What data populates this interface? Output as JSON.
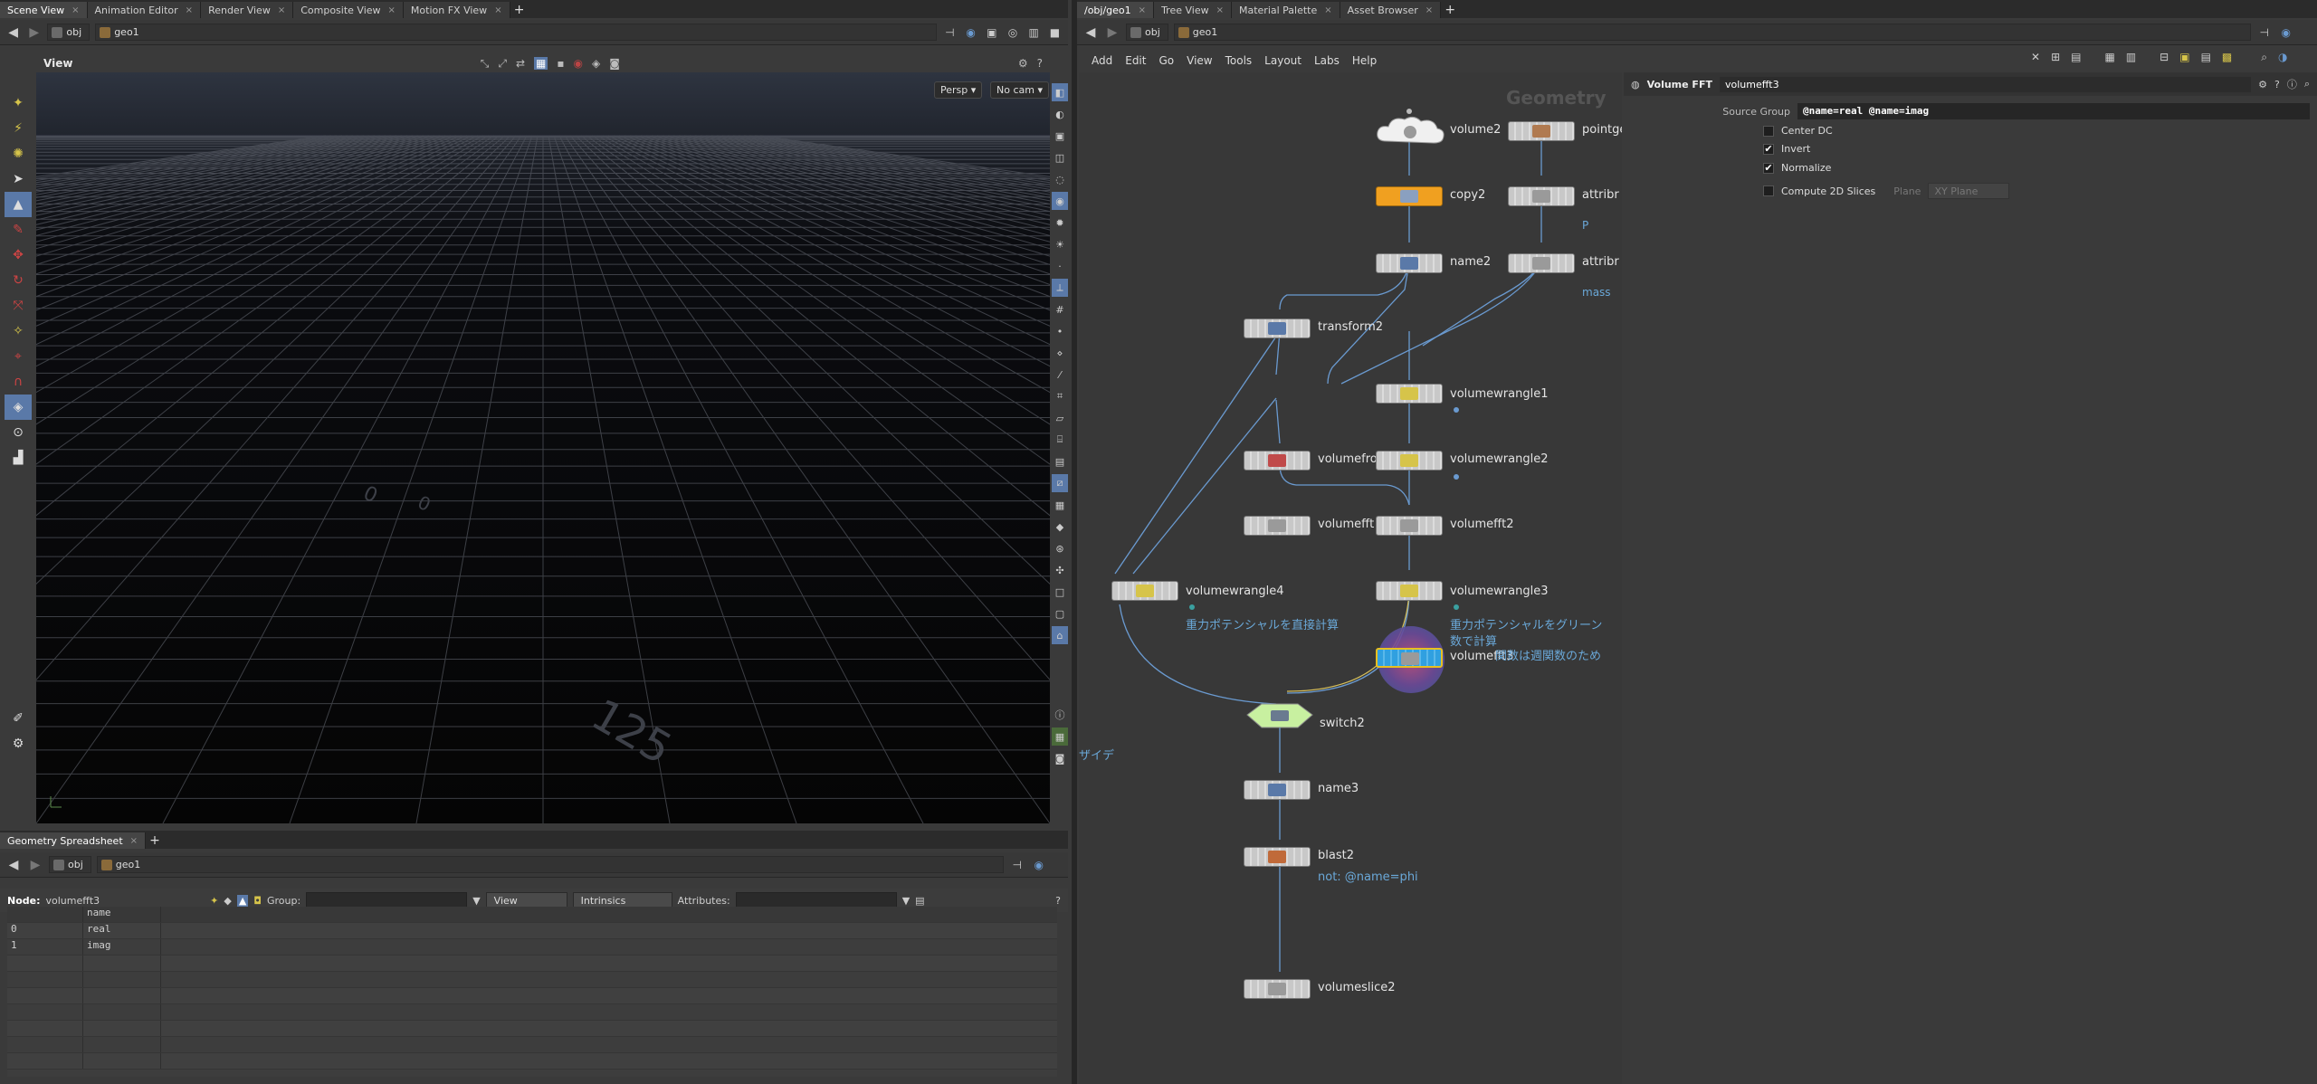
{
  "left_tabs": [
    {
      "label": "Scene View",
      "active": true
    },
    {
      "label": "Animation Editor",
      "active": false
    },
    {
      "label": "Render View",
      "active": false
    },
    {
      "label": "Composite View",
      "active": false
    },
    {
      "label": "Motion FX View",
      "active": false
    }
  ],
  "right_tabs": [
    {
      "label": "/obj/geo1",
      "active": true
    },
    {
      "label": "Tree View",
      "active": false
    },
    {
      "label": "Material Palette",
      "active": false
    },
    {
      "label": "Asset Browser",
      "active": false
    }
  ],
  "left_path": {
    "level1": "obj",
    "level2": "geo1"
  },
  "right_path": {
    "level1": "obj",
    "level2": "geo1"
  },
  "viewport": {
    "title": "View",
    "persp_label": "Persp ▾",
    "cam_label": "No cam ▾",
    "grid_labels": [
      "0",
      "0",
      "125"
    ]
  },
  "spreadsheet": {
    "tab_label": "Geometry Spreadsheet",
    "path": {
      "level1": "obj",
      "level2": "geo1"
    },
    "node_label": "Node:",
    "node_value": "volumefft3",
    "group_label": "Group:",
    "view_label": "View",
    "intrinsics_label": "Intrinsics",
    "attributes_label": "Attributes:",
    "column_header": "name",
    "rows": [
      {
        "index": "0",
        "name": "real"
      },
      {
        "index": "1",
        "name": "imag"
      }
    ]
  },
  "network": {
    "menu": [
      "Add",
      "Edit",
      "Go",
      "View",
      "Tools",
      "Layout",
      "Labs",
      "Help"
    ],
    "context_title": "Geometry",
    "side_note": "ザイデ",
    "nodes": [
      {
        "name": "volume2"
      },
      {
        "name": "pointge"
      },
      {
        "name": "copy2"
      },
      {
        "name": "attribr"
      },
      {
        "name": "name2"
      },
      {
        "name": "attribr"
      },
      {
        "name": "transform2"
      },
      {
        "name": "volumewrangle1"
      },
      {
        "name": "volumefro"
      },
      {
        "name": "volumewrangle2"
      },
      {
        "name": "volumefft"
      },
      {
        "name": "volumefft2"
      },
      {
        "name": "volumewrangle4"
      },
      {
        "name": "volumewrangle3"
      },
      {
        "name": "volumefft3"
      },
      {
        "name": "switch2"
      },
      {
        "name": "name3"
      },
      {
        "name": "blast2"
      },
      {
        "name": "volumeslice2"
      }
    ],
    "notes": {
      "attrib1_note": "P",
      "attrib2_note": "mass",
      "wrangle4_note": "重力ポテンシャルを直接計算",
      "wrangle3_note_line1": "重力ポテンシャルをグリーン",
      "wrangle3_note_line2": "数で計算",
      "fft3_note": "関数は週関数のため",
      "blast_note": "not: @name=phi"
    }
  },
  "parameters": {
    "node_type": "Volume FFT",
    "node_name": "volumefft3",
    "source_group_label": "Source Group",
    "source_group_value": "@name=real @name=imag",
    "center_dc": {
      "label": "Center DC",
      "checked": false
    },
    "invert": {
      "label": "Invert",
      "checked": true
    },
    "normalize": {
      "label": "Normalize",
      "checked": true
    },
    "compute_2d": {
      "label": "Compute 2D Slices",
      "checked": false
    },
    "plane_label": "Plane",
    "plane_value": "XY Plane"
  },
  "colors": {
    "copy_node": "#f0a020",
    "switch_node": "#c8f0a0",
    "selected_outline": "#e8c020",
    "wire": "#6a9ad0",
    "note_text": "#6aa8d8"
  }
}
